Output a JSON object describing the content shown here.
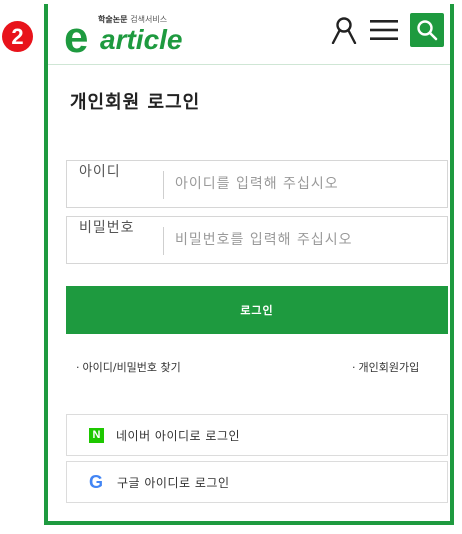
{
  "step_badge": "2",
  "brand": {
    "tagline_bold": "학술논문",
    "tagline_light": "검색서비스",
    "logo_letter": "e",
    "logo_word": "article",
    "accent_color": "#1e9a3f"
  },
  "header": {
    "icons": [
      "user-icon",
      "menu-icon",
      "search-icon"
    ]
  },
  "page": {
    "title": "개인회원 로그인"
  },
  "form": {
    "id_label": "아이디",
    "id_placeholder": "아이디를 입력해 주십시오",
    "id_value": "",
    "password_label": "비밀번호",
    "password_placeholder": "비밀번호를 입력해 주십시오",
    "password_value": "",
    "login_label": "로그인"
  },
  "links": {
    "bullet": "·",
    "find_account": "아이디/비밀번호 찾기",
    "signup": "개인회원가입"
  },
  "social": {
    "naver_icon_letter": "N",
    "naver_label": "네이버 아이디로 로그인",
    "google_icon_letter": "G",
    "google_label": "구글 아이디로 로그인"
  }
}
